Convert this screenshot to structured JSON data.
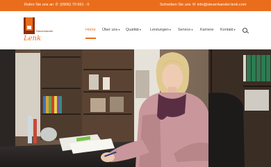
{
  "topbar": {
    "call_text": "Rufen Sie uns an",
    "phone": "(0906) 70 691 - 0",
    "mail_text": "Schreiben Sie uns",
    "email": "info@steuerkanzlei-lenk.com"
  },
  "logo": {
    "tagline": "Steuerkanzlei",
    "name": "Lenk"
  },
  "nav": {
    "items": [
      {
        "label": "Home",
        "active": true
      },
      {
        "label": "Über uns",
        "dropdown": true
      },
      {
        "label": "Qualität",
        "dropdown": true
      },
      {
        "label": "Leistungen",
        "dropdown": true
      },
      {
        "label": "Service",
        "dropdown": true
      },
      {
        "label": "Karriere"
      },
      {
        "label": "Kontakt",
        "dropdown": true
      }
    ],
    "search_icon": "search-icon"
  },
  "hero": {
    "description_icon": "office-photo"
  },
  "colors": {
    "accent": "#ea6d1c",
    "brand_dark": "#8b2f0d"
  }
}
